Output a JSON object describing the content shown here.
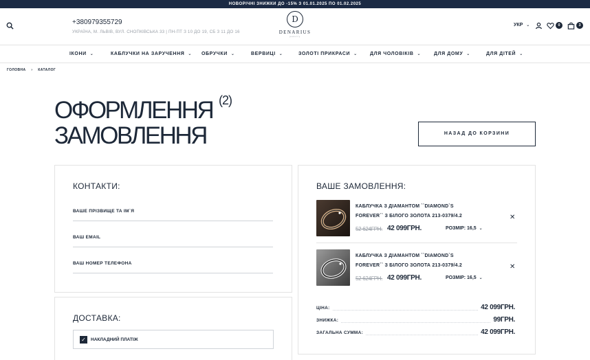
{
  "promo": "НОВОРІЧНІ ЗНИЖКИ ДО -15% З 01.01.2025 ПО 01.02.2025",
  "header": {
    "phone": "+380979355729",
    "address": "УКРАЇНА, М. ЛЬВІВ, ВУЛ. СНОПКІВСЬКА 33 | ПН-ПТ З 10 ДО 19, СБ З 11 ДО 16",
    "logo_letter": "D",
    "logo_name": "DENARIUS",
    "logo_sub": "jewelry",
    "lang": "УКР",
    "wishlist_count": "0",
    "cart_count": "3"
  },
  "nav": [
    "ІКОНИ",
    "КАБЛУЧКИ НА ЗАРУЧЕННЯ",
    "ОБРУЧКИ",
    "ВЕРВИЦІ",
    "ЗОЛОТІ ПРИКРАСИ",
    "ДЛЯ ЧОЛОВІКІВ",
    "ДЛЯ ДОМУ",
    "ДЛЯ ДІТЕЙ"
  ],
  "breadcrumbs": {
    "home": "ГОЛОВНА",
    "current": "КАТАЛОГ"
  },
  "page": {
    "title": "ОФОРМЛЕННЯ ЗАМОВЛЕННЯ",
    "count": "(2)",
    "back_button": "НАЗАД ДО КОРЗИНИ"
  },
  "contacts": {
    "title": "КОНТАКТИ:",
    "fields": [
      "ВАШЕ ПРІЗВИЩЕ ТА ІМ`Я",
      "ВАШ EMAIL",
      "ВАШ НОМЕР ТЕЛЕФОНА"
    ]
  },
  "delivery": {
    "title": "ДОСТАВКА:",
    "option": "НАКЛАДНИЙ ПЛАТІЖ"
  },
  "order": {
    "title": "ВАШЕ ЗАМОВЛЕННЯ:",
    "items": [
      {
        "name": "КАБЛУЧКА З ДІАМАНТОМ ``DIAMOND`S FOREVER`` З БІЛОГО ЗОЛОТА 213-0379/4.2",
        "old_price": "52 624ГРН.",
        "price": "42 099ГРН.",
        "size": "РОЗМІР: 16,5"
      },
      {
        "name": "КАБЛУЧКА З ДІАМАНТОМ ``DIAMOND`S FOREVER`` З БІЛОГО ЗОЛОТА 213-0379/4.2",
        "old_price": "52 624ГРН.",
        "price": "42 099ГРН.",
        "size": "РОЗМІР: 16,5"
      }
    ],
    "summary": [
      {
        "label": "ЦІНА:",
        "value": "42 099ГРН."
      },
      {
        "label": "ЗНИЖКА:",
        "value": "99ГРН."
      },
      {
        "label": "ЗАГАЛЬНА СУММА:",
        "value": "42 099ГРН."
      }
    ]
  }
}
